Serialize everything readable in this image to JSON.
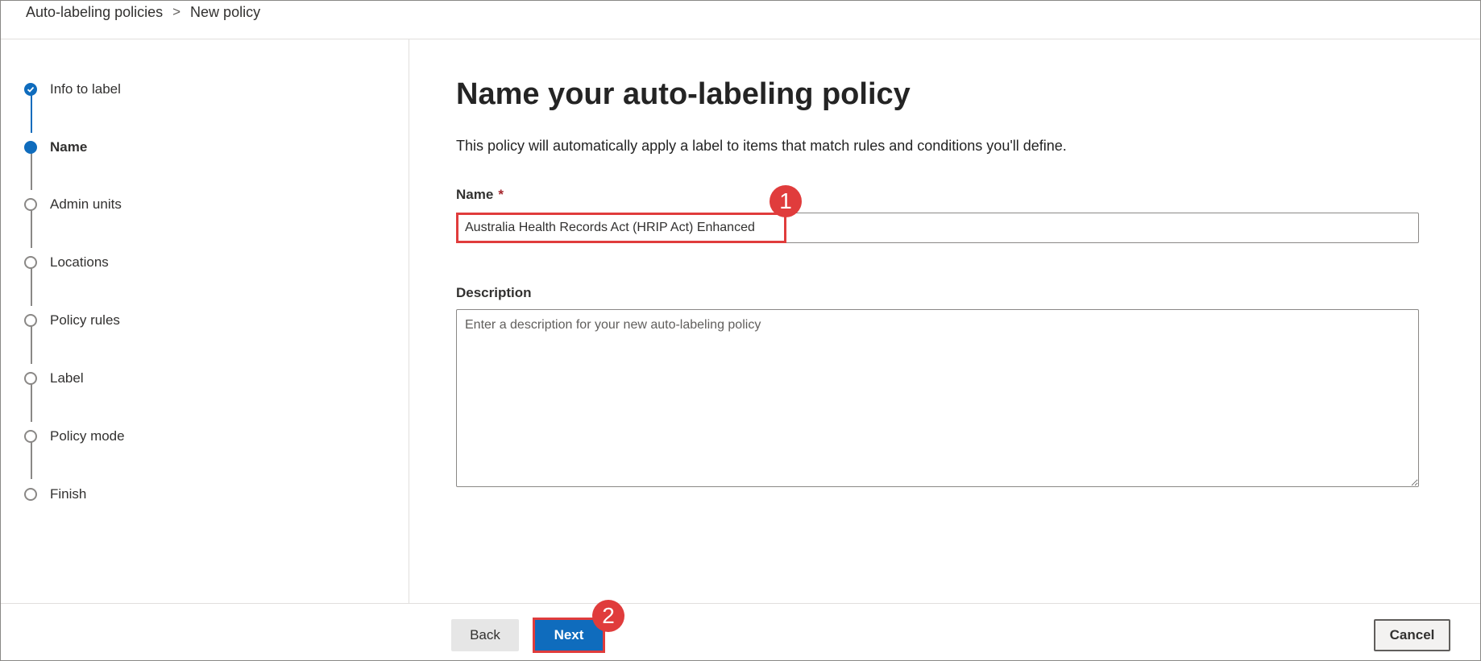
{
  "breadcrumb": {
    "parent": "Auto-labeling policies",
    "separator": ">",
    "current": "New policy"
  },
  "steps": [
    {
      "label": "Info to label",
      "state": "done"
    },
    {
      "label": "Name",
      "state": "current"
    },
    {
      "label": "Admin units",
      "state": "pending"
    },
    {
      "label": "Locations",
      "state": "pending"
    },
    {
      "label": "Policy rules",
      "state": "pending"
    },
    {
      "label": "Label",
      "state": "pending"
    },
    {
      "label": "Policy mode",
      "state": "pending"
    },
    {
      "label": "Finish",
      "state": "pending"
    }
  ],
  "main": {
    "title": "Name your auto-labeling policy",
    "description": "This policy will automatically apply a label to items that match rules and conditions you'll define.",
    "name_label": "Name",
    "required_marker": "*",
    "name_value": "Australia Health Records Act (HRIP Act) Enhanced",
    "description_label": "Description",
    "description_placeholder": "Enter a description for your new auto-labeling policy"
  },
  "footer": {
    "back_label": "Back",
    "next_label": "Next",
    "cancel_label": "Cancel"
  },
  "annotations": {
    "badge_1": "1",
    "badge_2": "2"
  },
  "colors": {
    "accent": "#0f6cbd",
    "annotation": "#e03c3c",
    "step_pending": "#8a8886"
  }
}
